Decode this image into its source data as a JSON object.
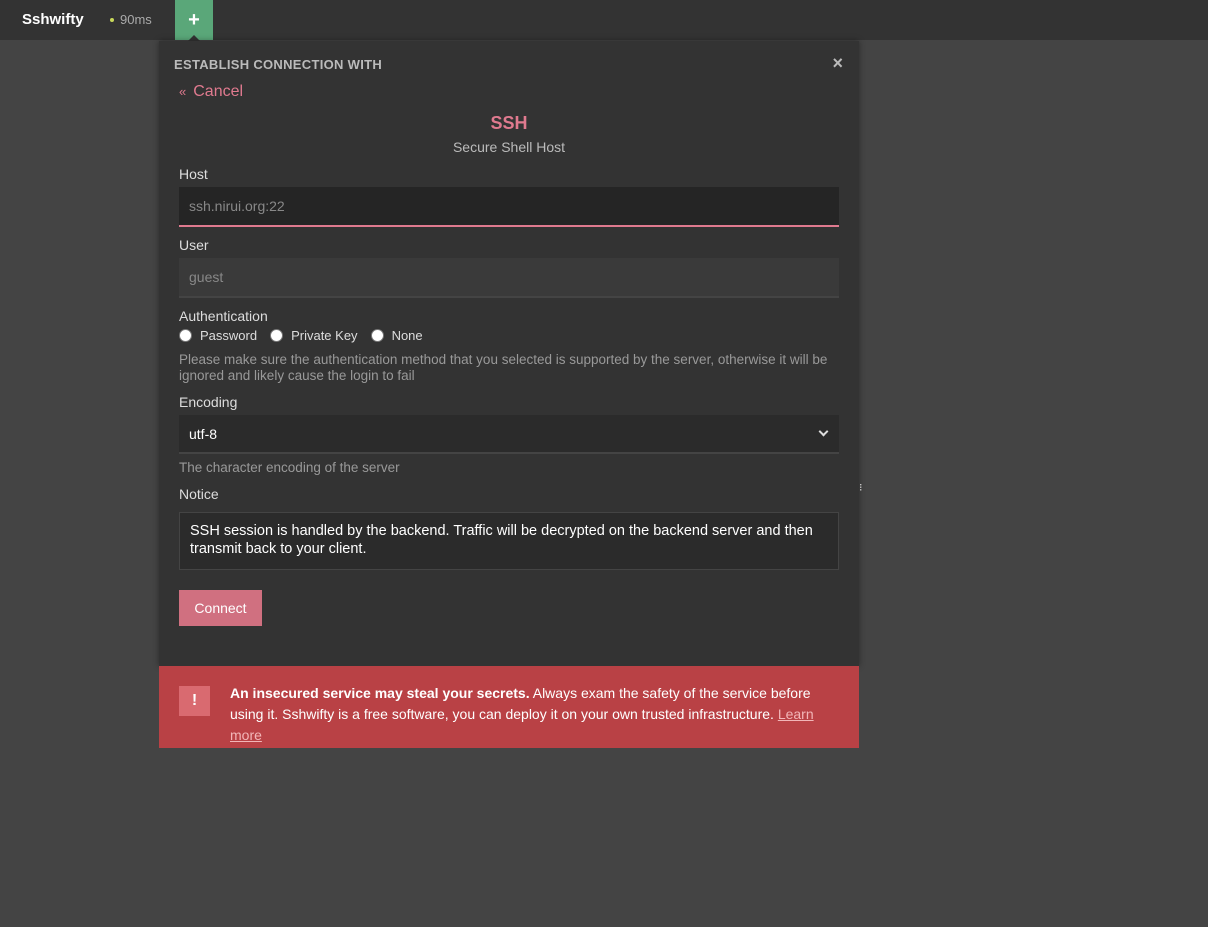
{
  "app": {
    "brand": "Sshwifty",
    "delay": "90ms",
    "add_tab": "+"
  },
  "dialog": {
    "title": "ESTABLISH CONNECTION WITH",
    "close": "×",
    "cancel_chevron": "«",
    "cancel_label": "Cancel",
    "protocol_title": "SSH",
    "protocol_subtitle": "Secure Shell Host",
    "host": {
      "label": "Host",
      "placeholder": "ssh.nirui.org:22",
      "value": ""
    },
    "user": {
      "label": "User",
      "placeholder": "guest",
      "value": ""
    },
    "authentication": {
      "label": "Authentication",
      "options": [
        "Password",
        "Private Key",
        "None"
      ],
      "help": "Please make sure the authentication method that you selected is supported by the server, otherwise it will be ignored and likely cause the login to fail"
    },
    "encoding": {
      "label": "Encoding",
      "selected": "utf-8",
      "help": "The character encoding of the server"
    },
    "notice": {
      "label": "Notice",
      "text": "SSH session is handled by the backend. Traffic will be decrypted on the backend server and then transmit back to your client."
    },
    "connect_label": "Connect"
  },
  "warning": {
    "icon": "!",
    "bold": "An insecured service may steal your secrets.",
    "text": " Always exam the safety of the service before using it. Sshwifty is a free software, you can deploy it on your own trusted infrastructure. ",
    "link": "Learn more"
  },
  "colors": {
    "accent": "#e07a8f",
    "add_tab": "#5aa779",
    "warning_bg": "#b94145",
    "background": "#444444",
    "panel": "#333333"
  }
}
